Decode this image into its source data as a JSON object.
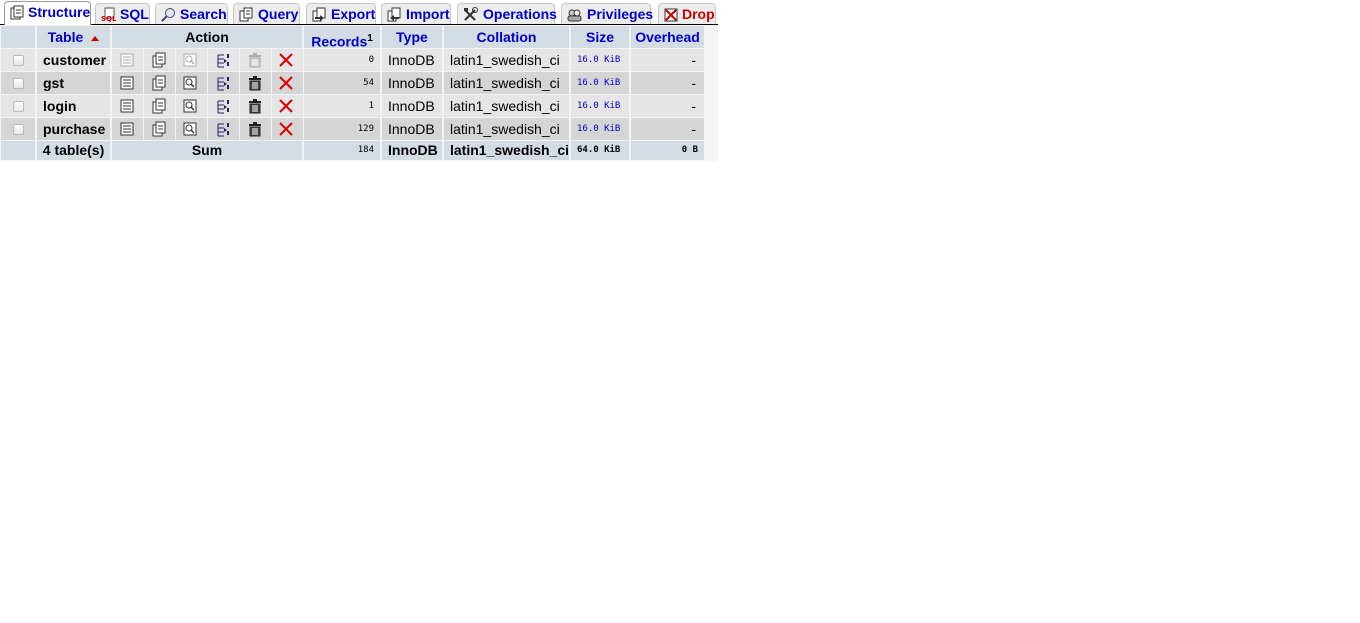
{
  "tabs": [
    {
      "label": "Structure",
      "icon": "structure-icon",
      "active": true
    },
    {
      "label": "SQL",
      "icon": "sql-icon"
    },
    {
      "label": "Search",
      "icon": "search-icon"
    },
    {
      "label": "Query",
      "icon": "query-icon"
    },
    {
      "label": "Export",
      "icon": "export-icon"
    },
    {
      "label": "Import",
      "icon": "import-icon"
    },
    {
      "label": "Operations",
      "icon": "operations-icon"
    },
    {
      "label": "Privileges",
      "icon": "privileges-icon"
    },
    {
      "label": "Drop",
      "icon": "drop-icon"
    }
  ],
  "headers": {
    "table": "Table",
    "action": "Action",
    "records": "Records",
    "records_sup": "1",
    "type": "Type",
    "collation": "Collation",
    "size": "Size",
    "overhead": "Overhead"
  },
  "action_icons": [
    "browse-icon",
    "structure-icon",
    "search-icon",
    "insert-icon",
    "empty-icon",
    "drop-icon"
  ],
  "rows": [
    {
      "name": "customer",
      "records": "0",
      "type": "InnoDB",
      "collation": "latin1_swedish_ci",
      "size": "16.0 KiB",
      "overhead": "-",
      "has_data": false
    },
    {
      "name": "gst",
      "records": "54",
      "type": "InnoDB",
      "collation": "latin1_swedish_ci",
      "size": "16.0 KiB",
      "overhead": "-",
      "has_data": true
    },
    {
      "name": "login",
      "records": "1",
      "type": "InnoDB",
      "collation": "latin1_swedish_ci",
      "size": "16.0 KiB",
      "overhead": "-",
      "has_data": true
    },
    {
      "name": "purchase",
      "records": "129",
      "type": "InnoDB",
      "collation": "latin1_swedish_ci",
      "size": "16.0 KiB",
      "overhead": "-",
      "has_data": true
    }
  ],
  "footer": {
    "count": "4 table(s)",
    "sum": "Sum",
    "records": "184",
    "type": "InnoDB",
    "collation": "latin1_swedish_ci",
    "size": "64.0 KiB",
    "overhead": "0 B"
  },
  "colors": {
    "link": "#0000cc",
    "header_bg": "#d3dce3",
    "row_odd": "#e5e5e5",
    "row_even": "#d5d5d5",
    "drop": "#cc0000"
  }
}
